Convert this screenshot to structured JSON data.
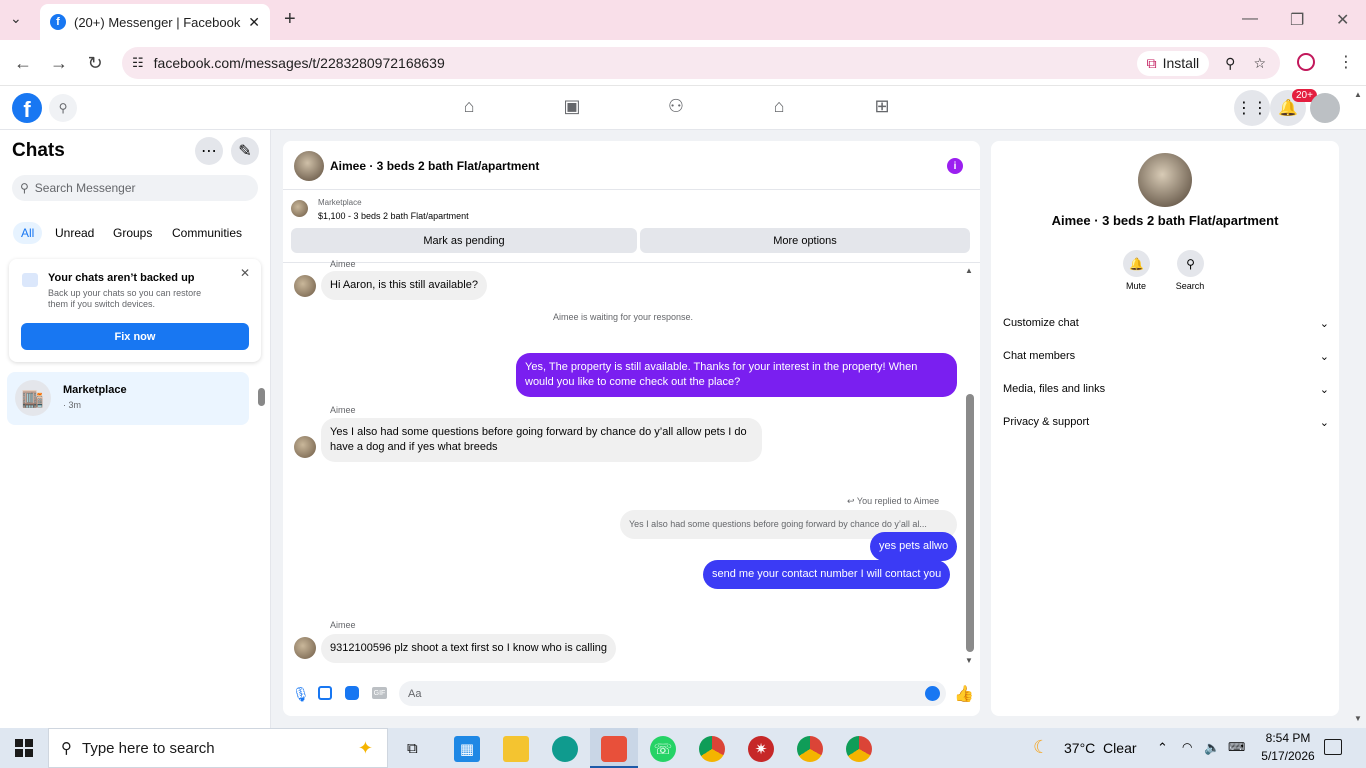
{
  "browser": {
    "tab_title": "(20+) Messenger | Facebook",
    "url": "facebook.com/messages/t/2283280972168639",
    "install_label": "Install"
  },
  "fb": {
    "notif_badge": "20+"
  },
  "chats": {
    "title": "Chats",
    "search_placeholder": "Search Messenger",
    "filters": [
      "All",
      "Unread",
      "Groups",
      "Communities"
    ],
    "backup": {
      "title": "Your chats aren’t backed up",
      "body": "Back up your chats so you can restore them if you switch devices.",
      "button": "Fix now"
    },
    "items": [
      {
        "name": "Marketplace",
        "meta": "· 3m"
      }
    ]
  },
  "conversation": {
    "header_title": "Aimee · 3 beds 2 bath Flat/apartment",
    "listing_source": "Marketplace",
    "listing_title": "$1,100 - 3 beds 2 bath Flat/apartment",
    "mark_pending": "Mark as pending",
    "more_options": "More options",
    "messages": [
      {
        "sender": "Aimee",
        "text": "Hi Aaron, is this still available?"
      },
      {
        "system": "Aimee is waiting for your response."
      },
      {
        "text": "Yes, The property is still available. Thanks for your interest in the property! When would you like to come check out the place?"
      },
      {
        "sender": "Aimee",
        "text": "Yes I also had some questions before going forward by chance do y’all allow pets I do have a dog and if yes what breeds"
      },
      {
        "reply_label": "You replied to Aimee",
        "quoted": "Yes I also had some questions before going forward by chance do y’all al..."
      },
      {
        "text": "yes pets allwo"
      },
      {
        "text": "send me your contact number I will contact you"
      },
      {
        "sender": "Aimee",
        "text": "9312100596 plz shoot a text first so I know who is calling"
      }
    ],
    "composer_placeholder": "Aa"
  },
  "details": {
    "title": "Aimee · 3 beds 2 bath Flat/apartment",
    "mute": "Mute",
    "search": "Search",
    "sections": [
      "Customize chat",
      "Chat members",
      "Media, files and links",
      "Privacy & support"
    ]
  },
  "taskbar": {
    "search_placeholder": "Type here to search",
    "weather": "37°C  Clear",
    "time": "8:54 PM",
    "date": "5/17/2026"
  },
  "colors": {
    "accent_purple": "#7a1ff0",
    "accent_blue": "#3b3bf5",
    "fb_blue": "#1877f2"
  }
}
